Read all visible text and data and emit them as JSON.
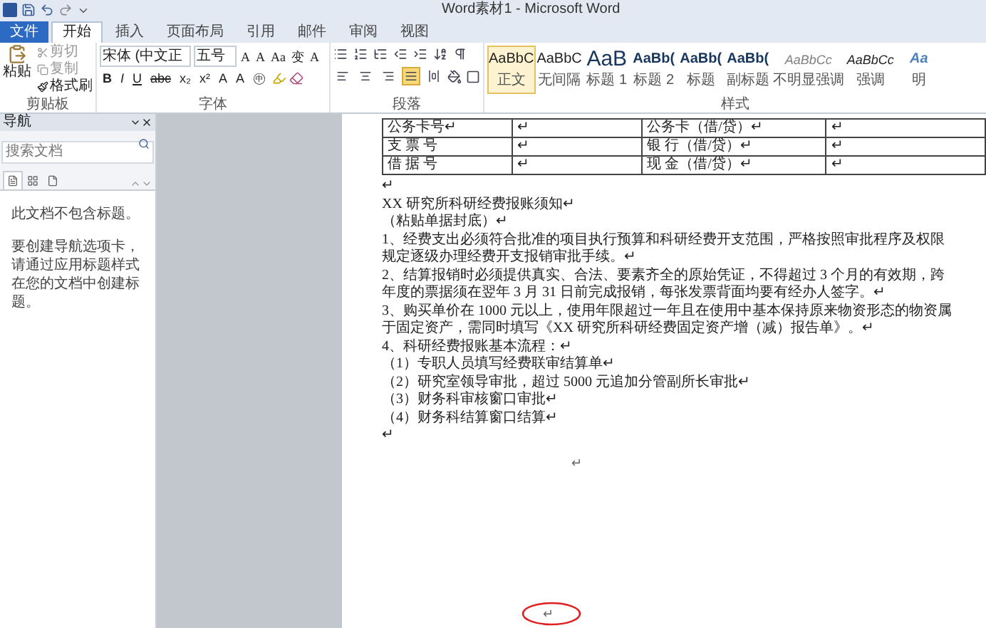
{
  "window": {
    "title": "Word素材1 - Microsoft Word"
  },
  "ribbon_tabs": [
    {
      "label": "文件",
      "kind": "file",
      "selected": false
    },
    {
      "label": "开始",
      "kind": "tab",
      "selected": true
    },
    {
      "label": "插入",
      "kind": "tab",
      "selected": false
    },
    {
      "label": "页面布局",
      "kind": "tab",
      "selected": false
    },
    {
      "label": "引用",
      "kind": "tab",
      "selected": false
    },
    {
      "label": "邮件",
      "kind": "tab",
      "selected": false
    },
    {
      "label": "审阅",
      "kind": "tab",
      "selected": false
    },
    {
      "label": "视图",
      "kind": "tab",
      "selected": false
    }
  ],
  "clipboard_group": {
    "label": "剪贴板",
    "paste": "粘贴",
    "items": [
      "剪切",
      "复制",
      "格式刷"
    ]
  },
  "font_group": {
    "label": "字体",
    "font_name": "宋体 (中文正",
    "font_size": "五号",
    "row_1": [
      "A",
      "A",
      "Aa",
      "变",
      "A"
    ],
    "row_2": [
      "B",
      "I",
      "U",
      "abc",
      "x₂",
      "x²",
      "A",
      "A",
      "㊥"
    ]
  },
  "paragraph_group": {
    "label": "段落",
    "align_buttons": [
      {
        "selected": false
      },
      {
        "selected": false
      },
      {
        "selected": false
      },
      {
        "selected": true
      },
      {
        "selected": false
      }
    ]
  },
  "styles_group": {
    "label": "样式",
    "styles": [
      {
        "preview": "AaBbC",
        "name": "正文",
        "selected": true,
        "kind": "normal"
      },
      {
        "preview": "AaBbC",
        "name": "无间隔",
        "selected": false,
        "kind": "normal"
      },
      {
        "preview": "AaB",
        "name": "标题 1",
        "selected": false,
        "kind": "heading1"
      },
      {
        "preview": "AaBb(",
        "name": "标题 2",
        "selected": false,
        "kind": "heading"
      },
      {
        "preview": "AaBb(",
        "name": "标题",
        "selected": false,
        "kind": "heading"
      },
      {
        "preview": "AaBb(",
        "name": "副标题",
        "selected": false,
        "kind": "heading"
      },
      {
        "preview": "AaBbCc",
        "name": "不明显强调",
        "selected": false,
        "kind": "subtle"
      },
      {
        "preview": "AaBbCc",
        "name": "强调",
        "selected": false,
        "kind": "emphasis"
      },
      {
        "preview": "Aa",
        "name": "明",
        "selected": false,
        "kind": "intense"
      }
    ]
  },
  "navigation_pane": {
    "title": "导航",
    "search": {
      "placeholder": "搜索文档"
    },
    "tabs": [
      {
        "selected": true
      },
      {
        "selected": false
      },
      {
        "selected": false
      }
    ],
    "messages": [
      "此文档不包含标题。",
      "要创建导航选项卡，请通过应用标题样式在您的文档中创建标题。"
    ]
  },
  "document": {
    "table": [
      [
        "公务卡号↵",
        "↵",
        "公务卡（借/贷）↵",
        "↵"
      ],
      [
        "支 票 号",
        "↵",
        "银 行（借/贷）↵",
        "↵"
      ],
      [
        "借 据 号",
        "↵",
        "现 金（借/贷）↵",
        "↵"
      ]
    ],
    "lines": [
      "↵",
      "XX 研究所科研经费报账须知↵",
      "（粘贴单据封底）↵",
      "1、经费支出必须符合批准的项目执行预算和科研经费开支范围，严格按照审批程序及权限",
      "规定逐级办理经费开支报销审批手续。↵",
      "2、结算报销时必须提供真实、合法、要素齐全的原始凭证，不得超过 3 个月的有效期，跨",
      "年度的票据须在翌年 3 月 31 日前完成报销，每张发票背面均要有经办人签字。↵",
      "3、购买单价在 1000 元以上，使用年限超过一年且在使用中基本保持原来物资形态的物资属",
      "于固定资产，需同时填写《XX 研究所科研经费固定资产增（减）报告单》。↵",
      "4、科研经费报账基本流程：↵",
      "（1）专职人员填写经费联审结算单↵",
      "（2）研究室领导审批，超过 5000 元追加分管副所长审批↵",
      "（3）财务科审核窗口审批↵",
      "（4）财务科结算窗口结算↵",
      "↵"
    ],
    "center_mark": "↵",
    "circled_mark": "↵"
  }
}
